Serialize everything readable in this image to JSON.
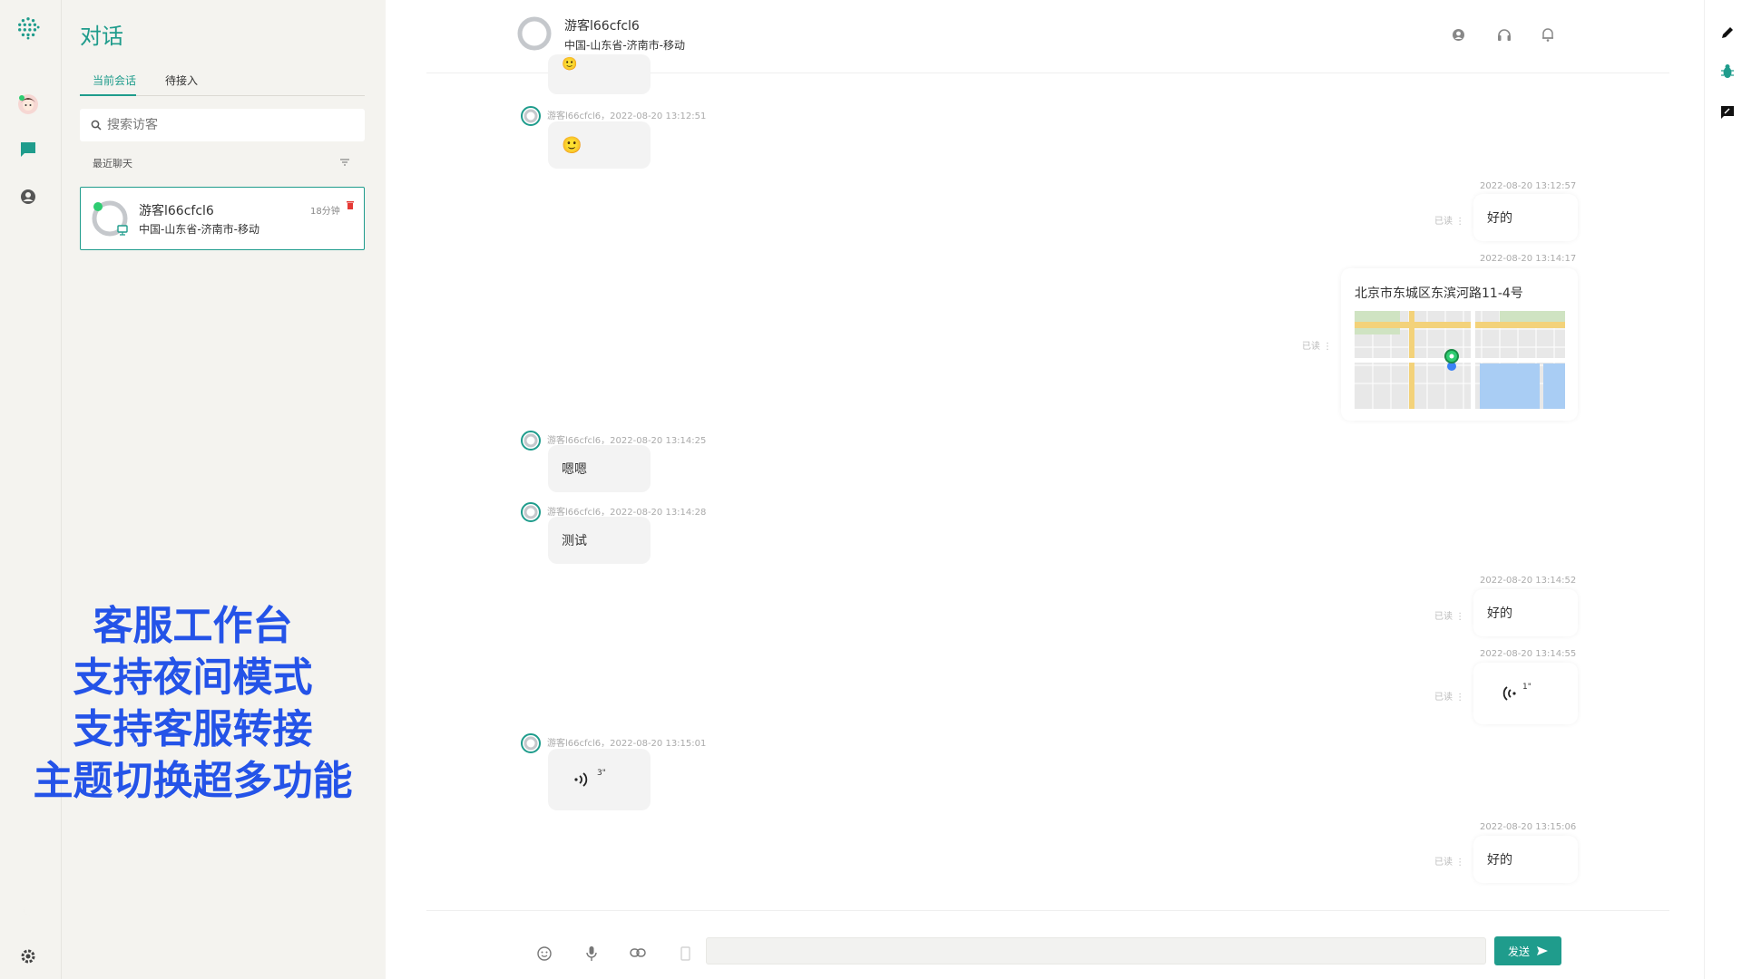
{
  "colors": {
    "accent": "#1f9c8c",
    "promo": "#2453e8",
    "delete": "#e53935",
    "online": "#2ecc71"
  },
  "panel": {
    "title": "对话",
    "tabs": [
      "当前会话",
      "待接入"
    ],
    "search_placeholder": "搜索访客",
    "recent_label": "最近聊天",
    "conversation": {
      "name": "游客l66cfcl6",
      "location": "中国-山东省-济南市-移动",
      "time": "18分钟"
    }
  },
  "promo_lines": [
    "客服工作台",
    "支持夜间模式",
    "支持客服转接",
    "主题切换超多功能"
  ],
  "header": {
    "name": "游客l66cfcl6",
    "location": "中国-山东省-济南市-移动"
  },
  "messages": {
    "m1": {
      "meta": "游客l66cfcl6，2022-08-20 13:12:51"
    },
    "m2": {
      "time": "2022-08-20 13:12:57",
      "text": "好的",
      "read": "已读 ⋮"
    },
    "m3": {
      "time": "2022-08-20 13:14:17",
      "address": "北京市东城区东滨河路11-4号",
      "read": "已读 ⋮"
    },
    "m4": {
      "meta": "游客l66cfcl6，2022-08-20 13:14:25",
      "text": "嗯嗯"
    },
    "m5": {
      "meta": "游客l66cfcl6，2022-08-20 13:14:28",
      "text": "测试"
    },
    "m6": {
      "time": "2022-08-20 13:14:52",
      "text": "好的",
      "read": "已读 ⋮"
    },
    "m7": {
      "time": "2022-08-20 13:14:55",
      "duration": "1\"",
      "read": "已读 ⋮"
    },
    "m8": {
      "meta": "游客l66cfcl6，2022-08-20 13:15:01",
      "duration": "3\""
    },
    "m9": {
      "time": "2022-08-20 13:15:06",
      "text": "好的",
      "read": "已读 ⋮"
    }
  },
  "composer": {
    "send_label": "发送"
  },
  "icons": [
    "logo-icon",
    "agent-avatar-icon",
    "chat-icon",
    "user-icon",
    "moon-icon",
    "settings-icon",
    "visitor-info-icon",
    "headset-icon",
    "bell-icon",
    "pen-icon",
    "bug-icon",
    "feedback-icon",
    "emoji-icon",
    "mic-icon",
    "link-icon",
    "phone-icon",
    "send-arrow-icon"
  ]
}
